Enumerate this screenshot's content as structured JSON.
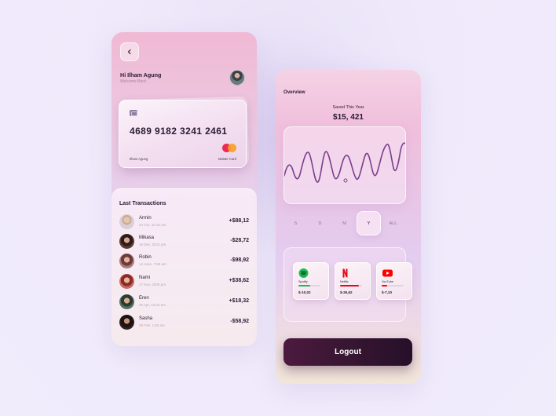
{
  "wallet_screen": {
    "greeting_name": "Hi Ilham Agung",
    "greeting_sub": "Welcome Back",
    "card": {
      "number": "4689 9182 3241 2461",
      "holder": "Ilham Agung",
      "brand": "Master Card"
    },
    "transactions_title": "Last Transactions",
    "transactions": [
      {
        "name": "Armin",
        "date": "24 Oct, 10:10 am",
        "amount": "+$88,12",
        "avatar": "person-avatar"
      },
      {
        "name": "Mikasa",
        "date": "18 Dec, 2012 pm",
        "amount": "-$28,72",
        "avatar": "person-avatar"
      },
      {
        "name": "Robin",
        "date": "14 June, 7:58 am",
        "amount": "-$98,92",
        "avatar": "person-avatar"
      },
      {
        "name": "Nami",
        "date": "17 Nov, 2009 pm",
        "amount": "+$38,62",
        "avatar": "person-avatar"
      },
      {
        "name": "Eren",
        "date": "20 Apr, 10:22 am",
        "amount": "+$18,32",
        "avatar": "person-avatar"
      },
      {
        "name": "Sasha",
        "date": "28 Feb, 1:52 am",
        "amount": "-$58,92",
        "avatar": "person-avatar"
      }
    ]
  },
  "overview_screen": {
    "title": "Overview",
    "saved_label": "Saved This Year",
    "saved_amount": "$15, 421",
    "periods": [
      "S",
      "D",
      "M",
      "Y",
      "ALL"
    ],
    "active_period": "Y",
    "subscriptions": [
      {
        "name": "Spotify",
        "amount": "$-10,02",
        "color": "#1db954",
        "icon": "spotify-icon",
        "progress": 0.55
      },
      {
        "name": "Netflix",
        "amount": "$-26,62",
        "color": "#e50914",
        "icon": "netflix-icon",
        "progress": 0.85
      },
      {
        "name": "YouTube",
        "amount": "$-7,10",
        "color": "#ff0000",
        "icon": "youtube-icon",
        "progress": 0.25
      }
    ],
    "logout_label": "Logout"
  },
  "colors": {
    "accent_dark": "#371631",
    "chart_line": "#7a3f8c"
  }
}
